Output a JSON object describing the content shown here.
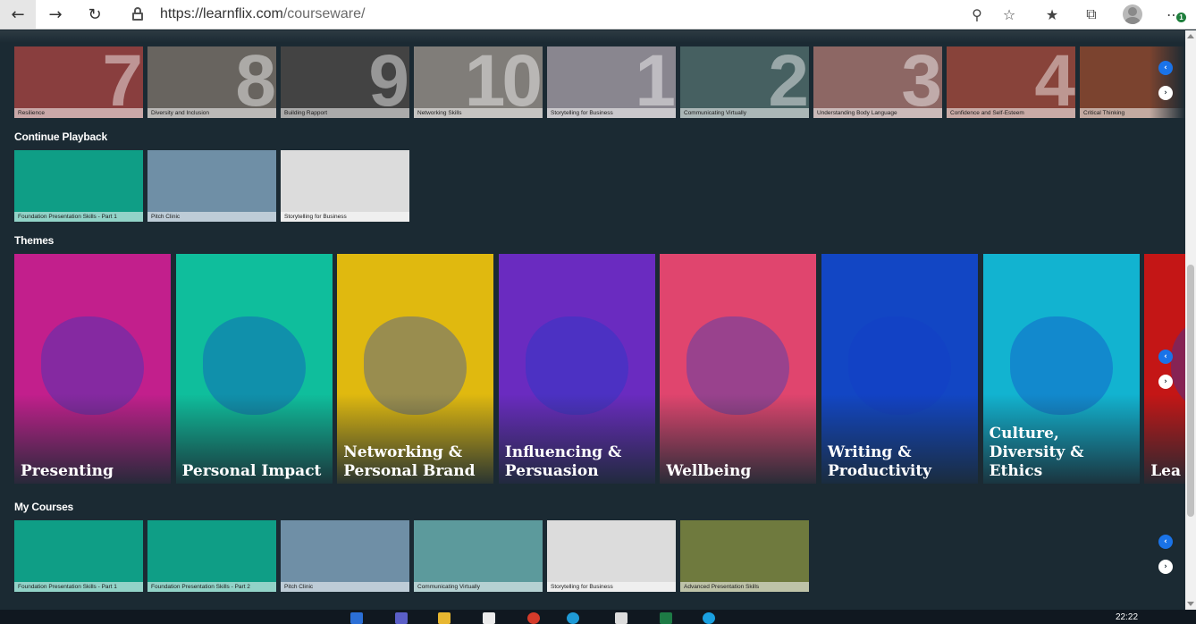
{
  "browser": {
    "url_host": "https://learnflix.com",
    "url_path": "/courseware/",
    "back_icon": "arrow-left-icon",
    "forward_icon": "arrow-right-icon",
    "reload_icon": "reload-icon",
    "zoom_icon": "zoom-out-icon",
    "favorite_icon": "star-icon",
    "favorites_icon": "favorites-list-icon",
    "collections_icon": "collections-icon",
    "profile_icon": "profile-avatar-icon",
    "menu_icon": "more-menu-icon",
    "update_badge": "1"
  },
  "ranked_row": {
    "items": [
      {
        "label": "Resilience",
        "rank": "7",
        "color": "#c94040"
      },
      {
        "label": "Diversity and Inclusion",
        "rank": "8",
        "color": "#8d857c"
      },
      {
        "label": "Building Rapport",
        "rank": "9",
        "color": "#4a4a4a"
      },
      {
        "label": "Networking Skills",
        "rank": "10",
        "color": "#b9b2ab"
      },
      {
        "label": "Storytelling for Business",
        "rank": "1",
        "color": "#c8c4d3"
      },
      {
        "label": "Communicating Virtually",
        "rank": "2",
        "color": "#4f7f80"
      },
      {
        "label": "Understanding Body Language",
        "rank": "3",
        "color": "#d08a86"
      },
      {
        "label": "Confidence and Self-Esteem",
        "rank": "4",
        "color": "#c74a3a"
      },
      {
        "label": "Critical Thinking",
        "rank": "",
        "color": "#b04a26"
      }
    ]
  },
  "continue_playback": {
    "title": "Continue Playback",
    "items": [
      {
        "label": "Foundation Presentation Skills - Part 1",
        "color": "#0f9e86"
      },
      {
        "label": "Pitch Clinic",
        "color": "#6f8fa6"
      },
      {
        "label": "Storytelling for Business",
        "color": "#dcdcdc"
      }
    ]
  },
  "themes": {
    "title": "Themes",
    "items": [
      {
        "label": "Presenting",
        "color": "#c21f8c"
      },
      {
        "label": "Personal Impact",
        "color": "#0fbe9c"
      },
      {
        "label": "Networking & Personal Brand",
        "color": "#e0b90f"
      },
      {
        "label": "Influencing & Persuasion",
        "color": "#6a2bc0"
      },
      {
        "label": "Wellbeing",
        "color": "#e0456e"
      },
      {
        "label": "Writing & Productivity",
        "color": "#1246c4"
      },
      {
        "label": "Culture, Diversity & Ethics",
        "color": "#12b3d0"
      },
      {
        "label": "Lea",
        "color": "#c41616"
      }
    ]
  },
  "my_courses": {
    "title": "My Courses",
    "items": [
      {
        "label": "Foundation Presentation Skills - Part 1",
        "color": "#0f9e86"
      },
      {
        "label": "Foundation Presentation Skills - Part 2",
        "color": "#0f9e86"
      },
      {
        "label": "Pitch Clinic",
        "color": "#6f8fa6"
      },
      {
        "label": "Communicating Virtually",
        "color": "#5c9a9c"
      },
      {
        "label": "Storytelling for Business",
        "color": "#dcdcdc"
      },
      {
        "label": "Advanced Presentation Skills",
        "color": "#6f7a3e"
      }
    ]
  },
  "carousel": {
    "prev_symbol": "‹",
    "next_symbol": "›"
  },
  "taskbar": {
    "clock": "22:22"
  }
}
